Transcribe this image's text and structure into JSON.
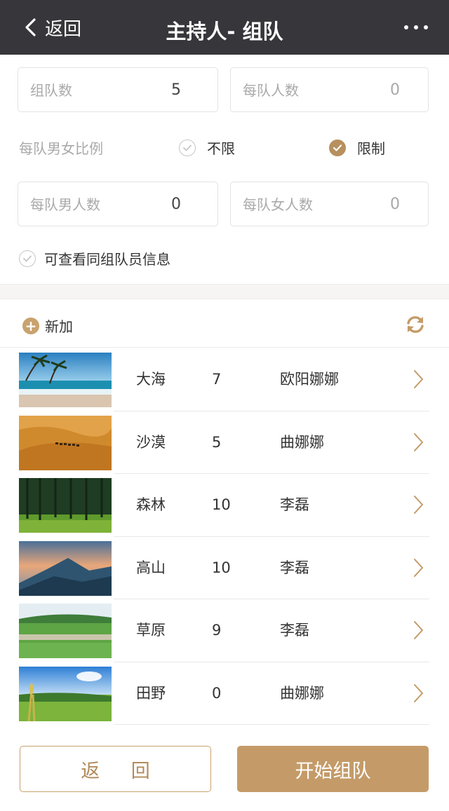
{
  "header": {
    "back_label": "返回",
    "title": "主持人- 组队"
  },
  "settings": {
    "team_count": {
      "label": "组队数",
      "value": "5"
    },
    "per_team": {
      "label": "每队人数",
      "value": "0"
    },
    "ratio_label": "每队男女比例",
    "ratio_options": [
      {
        "label": "不限",
        "checked": false
      },
      {
        "label": "限制",
        "checked": true
      }
    ],
    "male_count": {
      "label": "每队男人数",
      "value": "0"
    },
    "female_count": {
      "label": "每队女人数",
      "value": "0"
    },
    "view_members_label": "可查看同组队员信息"
  },
  "team_list": {
    "add_label": "新加",
    "teams": [
      {
        "name": "大海",
        "count": "7",
        "leader": "欧阳娜娜",
        "image": "sea-palm-photo"
      },
      {
        "name": "沙漠",
        "count": "5",
        "leader": "曲娜娜",
        "image": "desert-camel-photo"
      },
      {
        "name": "森林",
        "count": "10",
        "leader": "李磊",
        "image": "forest-photo"
      },
      {
        "name": "高山",
        "count": "10",
        "leader": "李磊",
        "image": "mountain-photo"
      },
      {
        "name": "草原",
        "count": "9",
        "leader": "李磊",
        "image": "grassland-sheep-photo"
      },
      {
        "name": "田野",
        "count": "0",
        "leader": "曲娜娜",
        "image": "field-wheat-photo"
      }
    ]
  },
  "footer": {
    "back_button": "返 回",
    "start_button": "开始组队"
  },
  "colors": {
    "navbar": "#37373b",
    "accent": "#c49b68"
  }
}
